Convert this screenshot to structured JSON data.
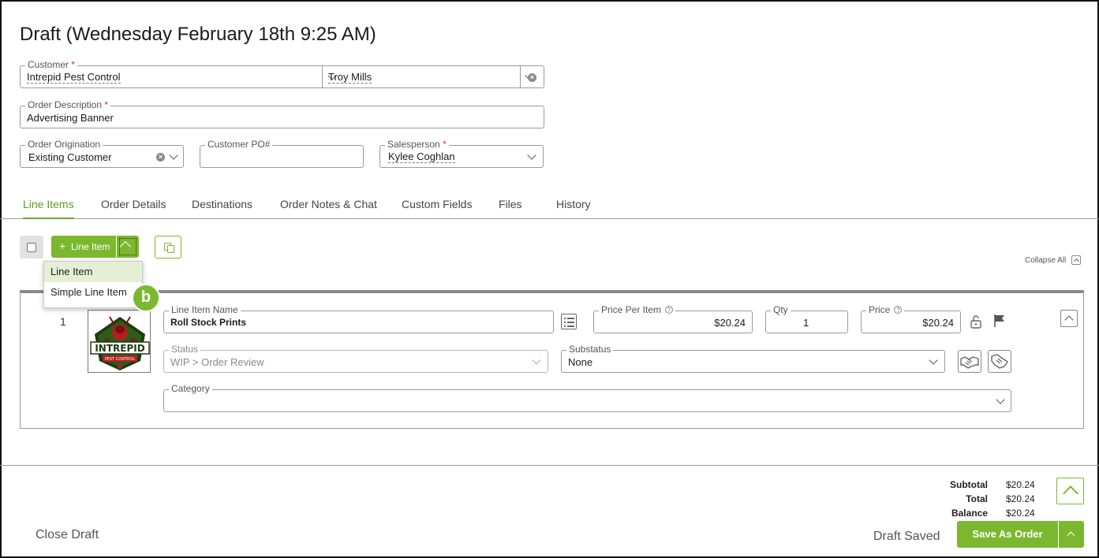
{
  "page_title": "Draft (Wednesday February 18th 9:25 AM)",
  "form": {
    "customer": {
      "label": "Customer",
      "required_mark": "*",
      "value": "Intrepid Pest Control",
      "contact": "Troy Mills"
    },
    "description": {
      "label": "Order Description",
      "required_mark": "*",
      "value": "Advertising Banner"
    },
    "origination": {
      "label": "Order Origination",
      "value": "Existing Customer"
    },
    "customer_po": {
      "label": "Customer PO#",
      "value": ""
    },
    "salesperson": {
      "label": "Salesperson",
      "required_mark": "*",
      "value": "Kylee Coghlan"
    }
  },
  "tabs": [
    "Line Items",
    "Order Details",
    "Destinations",
    "Order Notes & Chat",
    "Custom Fields",
    "Files",
    "History"
  ],
  "active_tab": "Line Items",
  "toolbar": {
    "add_label": "Line Item",
    "add_icon": "plus-icon",
    "collapse_all": "Collapse All"
  },
  "add_menu": {
    "items": [
      "Line Item",
      "Simple Line Item"
    ],
    "highlighted": "Line Item",
    "badge": "b"
  },
  "line_item": {
    "number": "1",
    "logo_text": "INTREPID",
    "logo_subtext": "PEST CONTROL",
    "name_label": "Line Item Name",
    "name": "Roll Stock Prints",
    "price_per_item_label": "Price Per Item",
    "price_per_item": "$20.24",
    "qty_label": "Qty",
    "qty": "1",
    "price_label": "Price",
    "price": "$20.24",
    "help_glyph": "?",
    "status_label": "Status",
    "status": "WIP > Order Review",
    "substatus_label": "Substatus",
    "substatus": "None",
    "category_label": "Category",
    "category": ""
  },
  "totals": {
    "subtotal_label": "Subtotal",
    "subtotal": "$20.24",
    "total_label": "Total",
    "total": "$20.24",
    "balance_label": "Balance",
    "balance": "$20.24"
  },
  "footer": {
    "close_draft": "Close Draft",
    "draft_saved": "Draft Saved",
    "save_as_order": "Save As Order"
  },
  "colors": {
    "accent": "#7cb82f",
    "tab_active": "#5a9e20",
    "required": "#d32f2f"
  }
}
